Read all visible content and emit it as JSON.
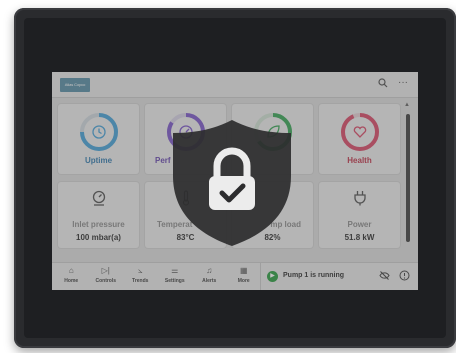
{
  "brand": {
    "logo_text": "Atlas Copco"
  },
  "topbar": {
    "search_icon": "search-icon",
    "more_icon": "more-icon",
    "more_glyph": "···"
  },
  "tiles_row1": [
    {
      "label": "Uptime",
      "icon": "clock-icon",
      "ring_color": "#4aa3d8",
      "label_color": "#3a7fb0"
    },
    {
      "label": "Perf",
      "icon": "gauge-icon",
      "ring_color": "#7e5bc9",
      "label_color": "#6a4bb0"
    },
    {
      "label": "",
      "icon": "leaf-icon",
      "ring_color": "#3da65a",
      "label_color": "#2f8a48"
    },
    {
      "label": "Health",
      "icon": "heart-icon",
      "ring_color": "#d94d6a",
      "label_color": "#c0394f"
    }
  ],
  "tiles_row2": [
    {
      "label": "Inlet pressure",
      "value": "100 mbar(a)",
      "icon": "pressure-gauge-icon"
    },
    {
      "label": "Temperat",
      "value": "83°C",
      "icon": "thermometer-icon"
    },
    {
      "label": "mp load",
      "value": "82%",
      "icon": ""
    },
    {
      "label": "Power",
      "value": "51.8 kW",
      "icon": "plug-icon"
    }
  ],
  "nav": [
    {
      "label": "Home",
      "icon": "home-icon",
      "glyph": "⌂"
    },
    {
      "label": "Controls",
      "icon": "play-pause-icon",
      "glyph": "▷|"
    },
    {
      "label": "Trends",
      "icon": "chart-icon",
      "glyph": "⦣"
    },
    {
      "label": "Settings",
      "icon": "sliders-icon",
      "glyph": "⚌"
    },
    {
      "label": "Alerts",
      "icon": "bell-icon",
      "glyph": "♫"
    },
    {
      "label": "More",
      "icon": "grid-icon",
      "glyph": "▦"
    }
  ],
  "status": {
    "text": "Pump 1 is running",
    "indicator_glyph": "▶",
    "left_icon": "eye-off-icon",
    "right_icon": "info-clock-icon"
  },
  "overlay": {
    "icon": "shield-lock-icon",
    "color": "#2c2c2e"
  }
}
